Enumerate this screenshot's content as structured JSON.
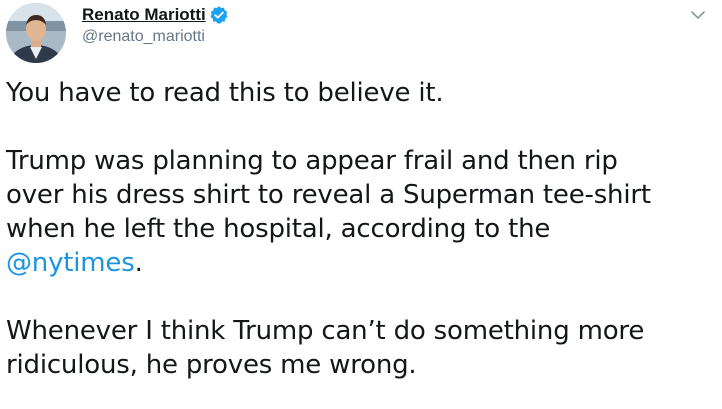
{
  "tweet": {
    "author": {
      "display_name": "Renato Mariotti",
      "handle": "@renato_mariotti",
      "verified": true,
      "avatar_icon": "profile-photo",
      "verified_icon": "verified-badge-icon"
    },
    "menu_icon": "chevron-down-icon",
    "paragraphs": {
      "p1": "You have to read this to believe it.",
      "p2_before": "Trump was planning to appear frail and then rip\nover his dress shirt to reveal a Superman tee-shirt\nwhen he left the hospital, according to the\n",
      "p2_mention": "@nytimes",
      "p2_after": ".",
      "p3": "Whenever I think Trump can’t do something more\nridiculous, he proves me wrong."
    },
    "colors": {
      "text": "#14171a",
      "secondary": "#657786",
      "link": "#1b95e0",
      "verified": "#1da1f2"
    }
  }
}
